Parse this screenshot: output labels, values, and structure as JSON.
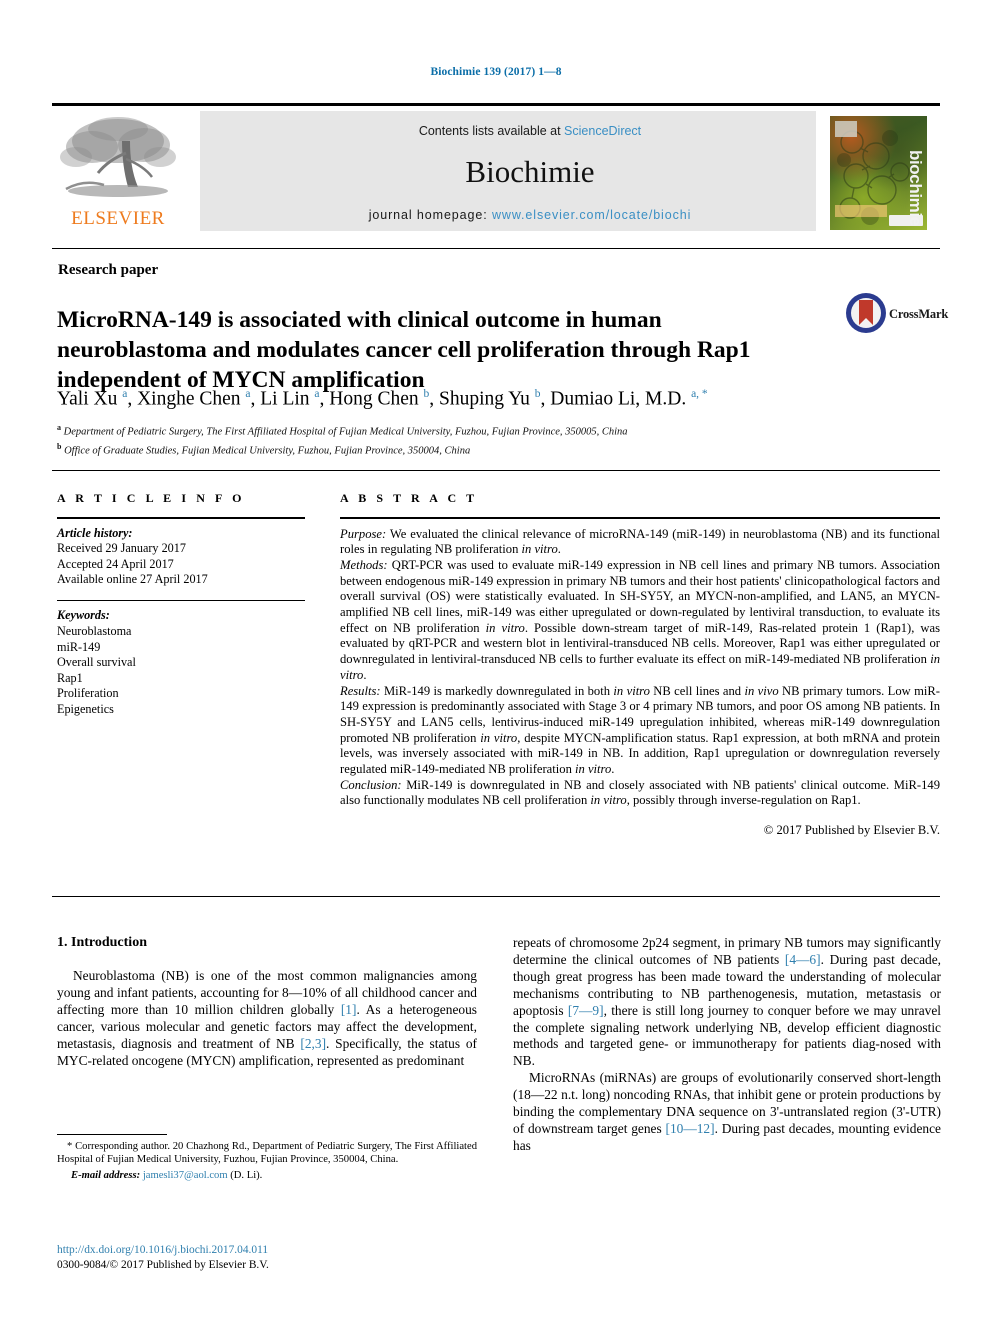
{
  "running_head": "Biochimie 139 (2017) 1—8",
  "masthead": {
    "publisher_name": "ELSEVIER",
    "contents_prefix": "Contents lists available at ",
    "contents_link": "ScienceDirect",
    "journal_name": "Biochimie",
    "homepage_prefix": "journal homepage: ",
    "homepage_link": "www.elsevier.com/locate/biochi",
    "cover_title": "biochimie",
    "accent_orange": "#ee7b1e",
    "link_blue": "#3a8fc4",
    "band_gray": "#e6e6e6"
  },
  "article": {
    "type": "Research paper",
    "title": "MicroRNA-149 is associated with clinical outcome in human neuroblastoma and modulates cancer cell proliferation through Rap1 independent of MYCN amplification",
    "crossmark_label": "CrossMark",
    "authors": [
      {
        "name": "Yali Xu",
        "sup": "a"
      },
      {
        "name": "Xinghe Chen",
        "sup": "a"
      },
      {
        "name": "Li Lin",
        "sup": "a"
      },
      {
        "name": "Hong Chen",
        "sup": "b"
      },
      {
        "name": "Shuping Yu",
        "sup": "b"
      },
      {
        "name": "Dumiao Li, M.D.",
        "sup": "a, *"
      }
    ],
    "affiliations": [
      {
        "marker": "a",
        "text": "Department of Pediatric Surgery, The First Affiliated Hospital of Fujian Medical University, Fuzhou, Fujian Province, 350005, China"
      },
      {
        "marker": "b",
        "text": "Office of Graduate Studies, Fujian Medical University, Fuzhou, Fujian Province, 350004, China"
      }
    ]
  },
  "article_info": {
    "heading": "A R T I C L E  I N F O",
    "history_label": "Article history:",
    "history": [
      "Received 29 January 2017",
      "Accepted 24 April 2017",
      "Available online 27 April 2017"
    ],
    "keywords_label": "Keywords:",
    "keywords": [
      "Neuroblastoma",
      "miR-149",
      "Overall survival",
      "Rap1",
      "Proliferation",
      "Epigenetics"
    ]
  },
  "abstract": {
    "heading": "A B S T R A C T",
    "purpose_label": "Purpose:",
    "purpose_text": " We evaluated the clinical relevance of microRNA-149 (miR-149) in neuroblastoma (NB) and its functional roles in regulating NB proliferation in vitro.",
    "methods_label": "Methods:",
    "methods_text": " QRT-PCR was used to evaluate miR-149 expression in NB cell lines and primary NB tumors. Association between endogenous miR-149 expression in primary NB tumors and their host patients' clinicopathological factors and overall survival (OS) were statistically evaluated. In SH-SY5Y, an MYCN-non-amplified, and LAN5, an MYCN-amplified NB cell lines, miR-149 was either upregulated or down-regulated by lentiviral transduction, to evaluate its effect on NB proliferation in vitro. Possible down-stream target of miR-149, Ras-related protein 1 (Rap1), was evaluated by qRT-PCR and western blot in lentiviral-transduced NB cells. Moreover, Rap1 was either upregulated or downregulated in lentiviral-transduced NB cells to further evaluate its effect on miR-149-mediated NB proliferation in vitro.",
    "results_label": "Results:",
    "results_text": " MiR-149 is markedly downregulated in both in vitro NB cell lines and in vivo NB primary tumors. Low miR-149 expression is predominantly associated with Stage 3 or 4 primary NB tumors, and poor OS among NB patients. In SH-SY5Y and LAN5 cells, lentivirus-induced miR-149 upregulation inhibited, whereas miR-149 downregulation promoted NB proliferation in vitro, despite MYCN-amplification status. Rap1 expression, at both mRNA and protein levels, was inversely associated with miR-149 in NB. In addition, Rap1 upregulation or downregulation reversely regulated miR-149-mediated NB proliferation in vitro.",
    "conclusion_label": "Conclusion:",
    "conclusion_text": " MiR-149 is downregulated in NB and closely associated with NB patients' clinical outcome. MiR-149 also functionally modulates NB cell proliferation in vitro, possibly through inverse-regulation on Rap1.",
    "copyright": "© 2017 Published by Elsevier B.V."
  },
  "introduction": {
    "section_number_title": "1.  Introduction",
    "left_paragraph_1": "Neuroblastoma (NB) is one of the most common malignancies among young and infant patients, accounting for 8—10% of all childhood cancer and affecting more than 10 million children globally [1]. As a heterogeneous cancer, various molecular and genetic factors may affect the development, metastasis, diagnosis and treatment of NB [2,3]. Specifically, the status of MYC-related oncogene (MYCN) amplification, represented as predominant",
    "right_paragraph_1": "repeats of chromosome 2p24 segment, in primary NB tumors may significantly determine the clinical outcomes of NB patients [4—6]. During past decade, though great progress has been made toward the understanding of molecular mechanisms contributing to NB parthenogenesis, mutation, metastasis or apoptosis [7—9], there is still long journey to conquer before we may unravel the complete signaling network underlying NB, develop efficient diagnostic methods and targeted gene- or immunotherapy for patients diag-nosed with NB.",
    "right_paragraph_2": "MicroRNAs (miRNAs) are groups of evolutionarily conserved short-length (18—22 n.t. long) noncoding RNAs, that inhibit gene or protein productions by binding the complementary DNA sequence on 3'-untranslated region (3'-UTR) of downstream target genes [10—12]. During past decades, mounting evidence has",
    "refs": {
      "r1": "[1]",
      "r2": "[2,3]",
      "r3": "[4—6]",
      "r4": "[7—9]",
      "r5": "[10—12]"
    }
  },
  "footer": {
    "corresponding_marker": "*",
    "corresponding_text": " Corresponding author. 20 Chazhong Rd., Department of Pediatric Surgery, The First Affiliated Hospital of Fujian Medical University, Fuzhou, Fujian Province, 350004, China.",
    "email_label": "E-mail address:",
    "email_address": "jamesli37@aol.com",
    "email_suffix": " (D. Li).",
    "doi_url": "http://dx.doi.org/10.1016/j.biochi.2017.04.011",
    "issn_line": "0300-9084/© 2017 Published by Elsevier B.V."
  }
}
